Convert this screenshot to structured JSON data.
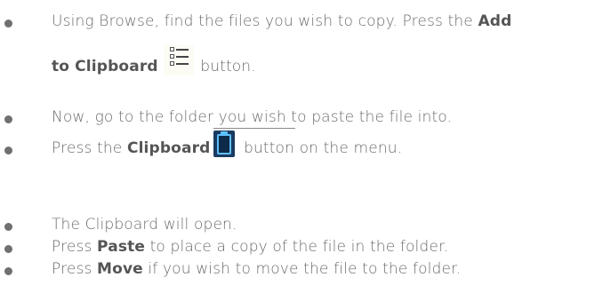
{
  "steps": [
    {
      "line1_pre": "Using Browse, find the files you wish to copy. Press the ",
      "line1_bold": "Add",
      "line2_bold": "to Clipboard",
      "line2_post": " button.",
      "icon": "list-icon"
    },
    {
      "text": "Now, go to the folder you wish to paste the file into."
    },
    {
      "pre": "Press the ",
      "bold": "Clipboard",
      "post": " button on the menu.",
      "icon": "clipboard-icon"
    },
    {
      "text": "The Clipboard will open."
    },
    {
      "pre": "Press ",
      "bold": "Paste",
      "post": " to place a copy of the file in the folder."
    },
    {
      "pre": "Press ",
      "bold": "Move",
      "post": " if you wish to move the file to the folder."
    }
  ],
  "colors": {
    "text": "#6b6b6b",
    "bold": "#555555",
    "clipboard_icon_bg": "#1a3a60",
    "clipboard_icon_accent": "#5ec0ff"
  }
}
